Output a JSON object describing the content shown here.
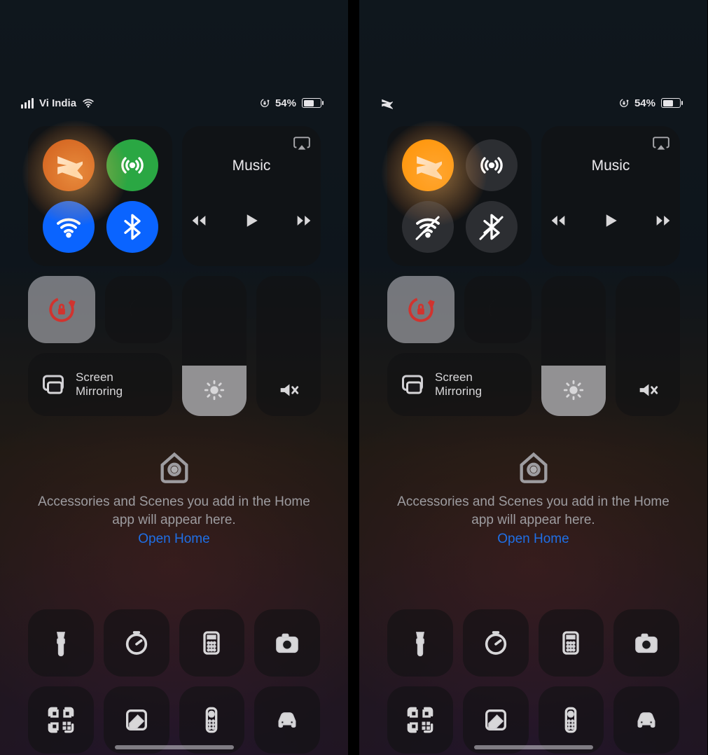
{
  "left": {
    "status": {
      "carrier": "Vi India",
      "battery_pct": "54%",
      "airplane_on": false
    },
    "connectivity": {
      "airplane": {
        "on": false,
        "highlighted": true
      },
      "cellular": {
        "on": true
      },
      "wifi": {
        "on": true
      },
      "bluetooth": {
        "on": true
      }
    },
    "media": {
      "title": "Music"
    },
    "orientation_lock": {
      "on": true
    },
    "dnd": {
      "on": false
    },
    "screen_mirroring": {
      "label_line1": "Screen",
      "label_line2": "Mirroring"
    },
    "brightness_pct": 36,
    "volume_muted": true,
    "home": {
      "message": "Accessories and Scenes you add in the Home app will appear here.",
      "link": "Open Home"
    },
    "shortcuts": [
      "flashlight",
      "timer",
      "calculator",
      "camera",
      "qr-scanner",
      "notes",
      "apple-tv-remote",
      "carplay"
    ]
  },
  "right": {
    "status": {
      "carrier": "",
      "battery_pct": "54%",
      "airplane_on": true
    },
    "connectivity": {
      "airplane": {
        "on": true,
        "highlighted": true
      },
      "cellular": {
        "on": false
      },
      "wifi": {
        "on": false,
        "slashed": true
      },
      "bluetooth": {
        "on": false,
        "slashed": true
      }
    },
    "media": {
      "title": "Music"
    },
    "orientation_lock": {
      "on": true
    },
    "dnd": {
      "on": false
    },
    "screen_mirroring": {
      "label_line1": "Screen",
      "label_line2": "Mirroring"
    },
    "brightness_pct": 36,
    "volume_muted": true,
    "home": {
      "message": "Accessories and Scenes you add in the Home app will appear here.",
      "link": "Open Home"
    },
    "shortcuts": [
      "flashlight",
      "timer",
      "calculator",
      "camera",
      "qr-scanner",
      "notes",
      "apple-tv-remote",
      "carplay"
    ]
  }
}
